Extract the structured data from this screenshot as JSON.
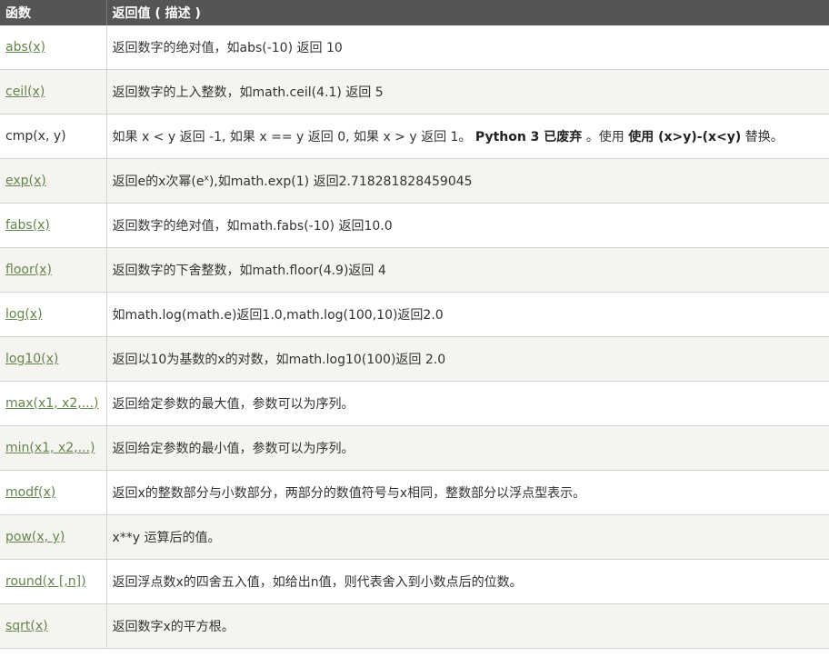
{
  "header": {
    "col_function": "函数",
    "col_return": "返回值 ( 描述 )"
  },
  "rows": [
    {
      "name": "abs(x)",
      "desc": "返回数字的绝对值，如abs(-10) 返回 10"
    },
    {
      "name": "ceil(x)",
      "desc": "返回数字的上入整数，如math.ceil(4.1) 返回 5"
    },
    {
      "name": "cmp(x, y)",
      "desc_a": "如果 x < y 返回 -1, 如果 x == y 返回 0, 如果 x > y 返回 1。 ",
      "desc_b": "Python 3 已废弃",
      "desc_c": " 。使用 ",
      "desc_d": "使用 (x>y)-(x<y)",
      "desc_e": " 替换。"
    },
    {
      "name": "exp(x)",
      "desc_a": "返回e的x次幂(e",
      "sup": "x",
      "desc_b": "),如math.exp(1) 返回2.718281828459045"
    },
    {
      "name": "fabs(x)",
      "desc": "返回数字的绝对值，如math.fabs(-10) 返回10.0"
    },
    {
      "name": "floor(x)",
      "desc": "返回数字的下舍整数，如math.floor(4.9)返回 4"
    },
    {
      "name": "log(x)",
      "desc": "如math.log(math.e)返回1.0,math.log(100,10)返回2.0"
    },
    {
      "name": "log10(x)",
      "desc": "返回以10为基数的x的对数，如math.log10(100)返回 2.0"
    },
    {
      "name": "max(x1, x2,...)",
      "desc": "返回给定参数的最大值，参数可以为序列。"
    },
    {
      "name": "min(x1, x2,...)",
      "desc": "返回给定参数的最小值，参数可以为序列。"
    },
    {
      "name": "modf(x)",
      "desc": "返回x的整数部分与小数部分，两部分的数值符号与x相同，整数部分以浮点型表示。"
    },
    {
      "name": "pow(x, y)",
      "desc": "x**y 运算后的值。"
    },
    {
      "name": "round(x [,n])",
      "desc": "返回浮点数x的四舍五入值，如给出n值，则代表舍入到小数点后的位数。"
    },
    {
      "name": "sqrt(x)",
      "desc": "返回数字x的平方根。"
    }
  ],
  "colors": {
    "header_bg": "#555555",
    "link": "#64854c",
    "row_alt": "#f6f4f0",
    "border": "#d4d4d4"
  }
}
